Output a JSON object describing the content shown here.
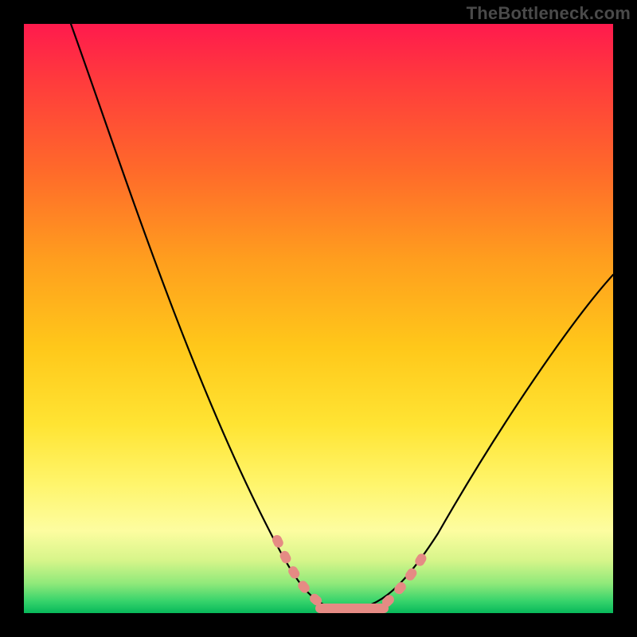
{
  "watermark": "TheBottleneck.com",
  "colors": {
    "frame": "#000000",
    "curve": "#000000",
    "marker": "#e58b84",
    "gradient_top": "#ff1a4d",
    "gradient_bottom": "#07b85a"
  },
  "chart_data": {
    "type": "line",
    "title": "",
    "xlabel": "",
    "ylabel": "",
    "xlim": [
      0,
      100
    ],
    "ylim": [
      0,
      100
    ],
    "x": [
      8,
      12,
      16,
      20,
      24,
      28,
      32,
      36,
      40,
      43,
      46,
      49,
      52,
      55,
      58,
      62,
      66,
      70,
      74,
      78,
      82,
      86,
      90,
      94,
      98,
      100
    ],
    "values": [
      100,
      90,
      80,
      70,
      60,
      50,
      41,
      33,
      25,
      18,
      12,
      7,
      3,
      1,
      0,
      0,
      1,
      3,
      7,
      12,
      18,
      25,
      33,
      41,
      49,
      53
    ],
    "annotations": [
      {
        "kind": "marker_cluster",
        "x_range": [
          46,
          52
        ],
        "note": "left cluster of pink beads"
      },
      {
        "kind": "flat_segment",
        "x_range": [
          52,
          62
        ],
        "note": "pink flat bottom segment"
      },
      {
        "kind": "marker_cluster",
        "x_range": [
          62,
          68
        ],
        "note": "right cluster of pink beads"
      }
    ]
  }
}
